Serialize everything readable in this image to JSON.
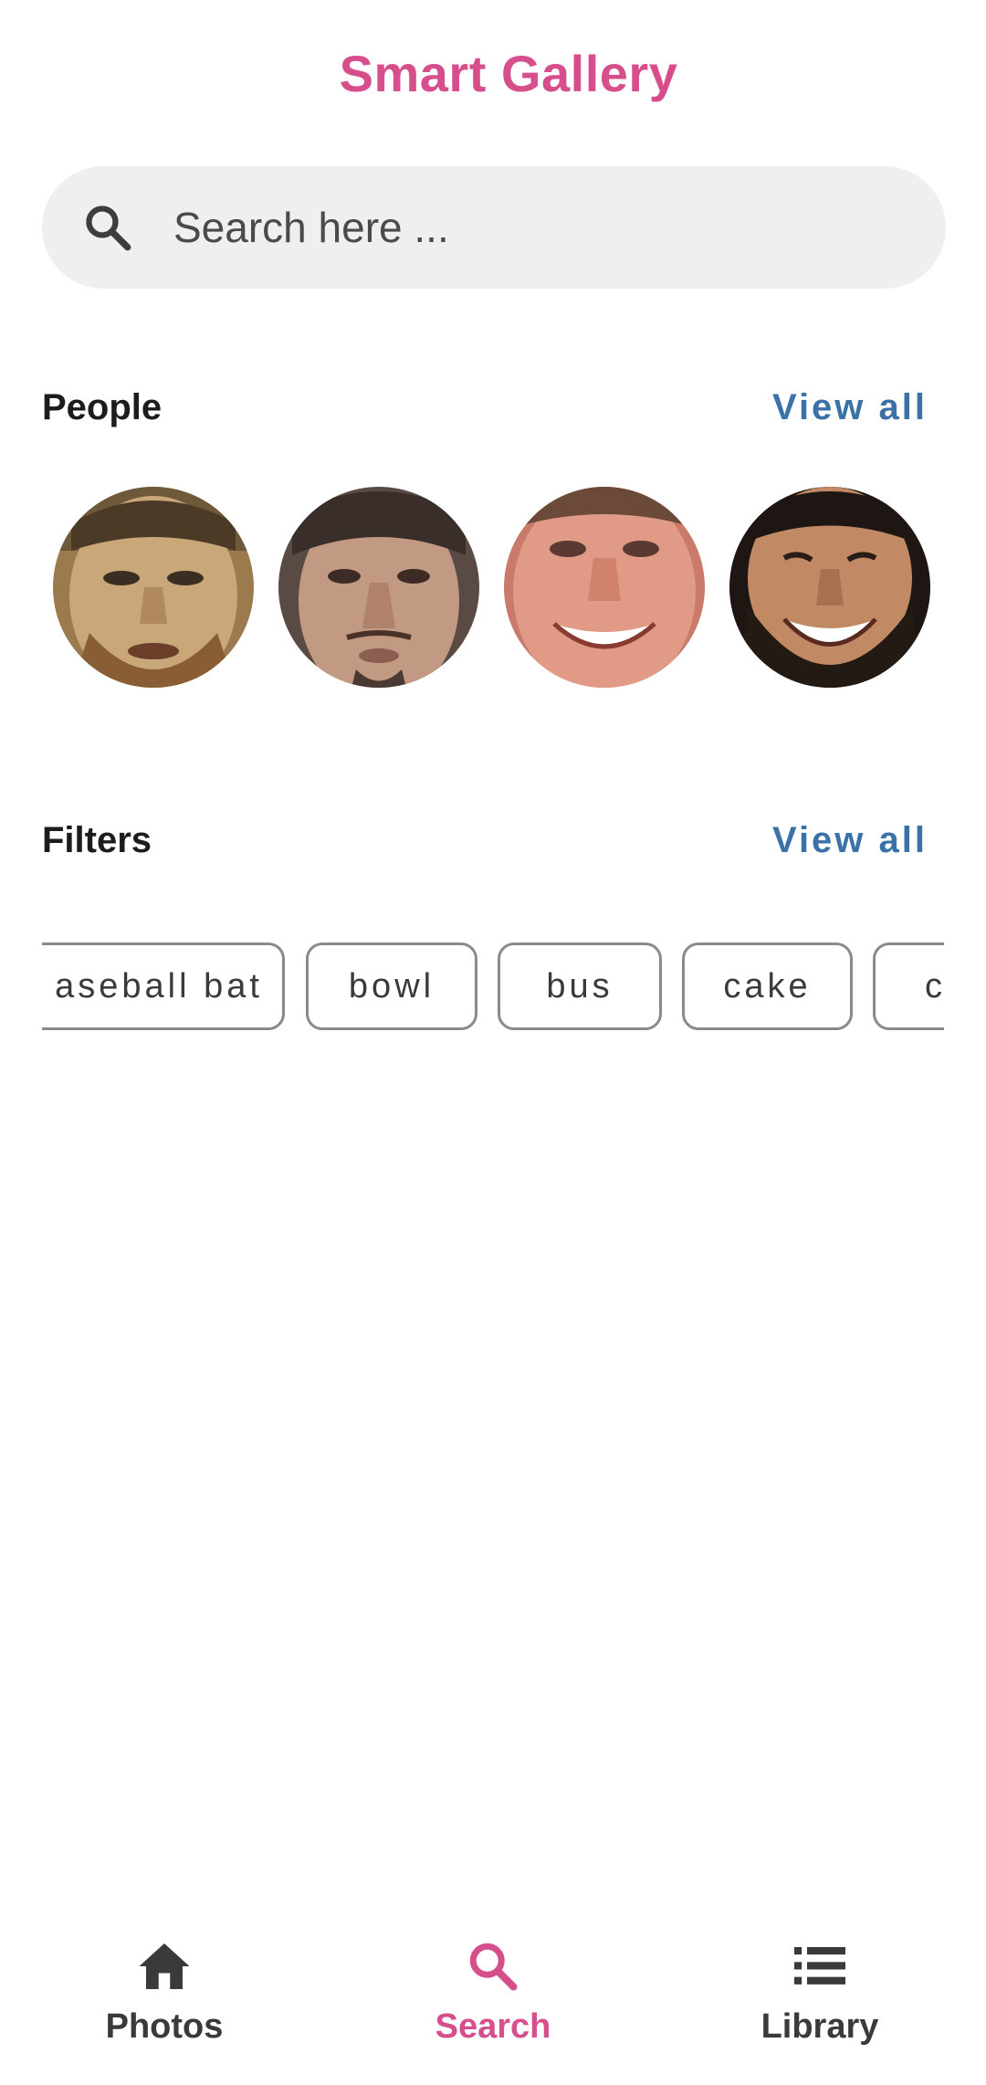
{
  "app": {
    "title": "Smart Gallery"
  },
  "search": {
    "placeholder": "Search here ...",
    "value": "",
    "icon": "search-icon"
  },
  "people": {
    "title": "People",
    "view_all_label": "View all",
    "avatars": [
      {
        "name": "person-1"
      },
      {
        "name": "person-2"
      },
      {
        "name": "person-3"
      },
      {
        "name": "person-4"
      }
    ]
  },
  "filters": {
    "title": "Filters",
    "view_all_label": "View all",
    "chips": [
      {
        "label": "aseball bat"
      },
      {
        "label": "bowl"
      },
      {
        "label": "bus"
      },
      {
        "label": "cake"
      },
      {
        "label": "c"
      }
    ]
  },
  "bottom_nav": {
    "items": [
      {
        "label": "Photos",
        "icon": "home-icon",
        "active": false
      },
      {
        "label": "Search",
        "icon": "search-icon",
        "active": true
      },
      {
        "label": "Library",
        "icon": "list-icon",
        "active": false
      }
    ]
  },
  "colors": {
    "accent": "#d64e8c",
    "link": "#3a72a8",
    "search_bg": "#efefef"
  }
}
